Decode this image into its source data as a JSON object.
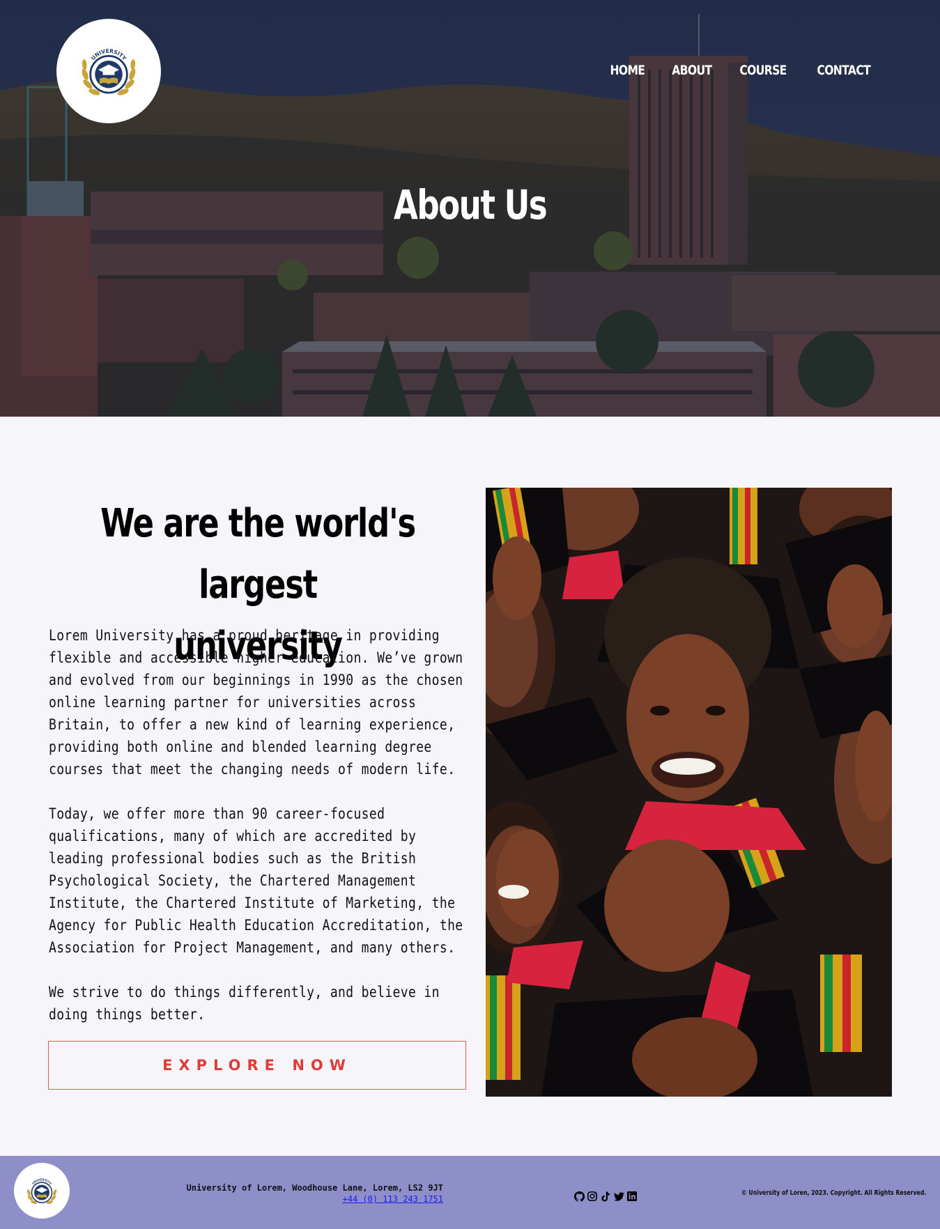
{
  "header": {
    "logo_text": "UNIVERSITY",
    "nav": [
      {
        "label": "HOME"
      },
      {
        "label": "ABOUT"
      },
      {
        "label": "COURSE"
      },
      {
        "label": "CONTACT"
      }
    ],
    "hero_title": "About Us"
  },
  "about": {
    "heading_line1": "We are the world's largest",
    "heading_line2": "university",
    "paragraphs": [
      "Lorem University has a proud heritage in providing flexible and accessible higher education. We’ve grown and evolved from our beginnings in 1990 as the chosen online learning partner for universities across Britain, to offer a new kind of learning experience, providing both online and blended learning degree courses that meet the changing needs of modern life.",
      "Today, we offer more than 90 career-focused qualifications, many of which are accredited by leading professional bodies such as the British Psychological Society, the Chartered Management Institute, the Chartered Institute of Marketing, the Agency for Public Health Education Accreditation, the Association for Project Management, and many others.",
      "We strive to do things differently, and believe in doing things better."
    ],
    "button_label": "EXPLORE NOW"
  },
  "footer": {
    "logo_text": "UNIVERSITY",
    "address": "University of Lorem, Woodhouse Lane, Lorem, LS2 9JT",
    "phone": "+44 (0) 113 243 1751",
    "socials": [
      "github-icon",
      "instagram-icon",
      "tiktok-icon",
      "twitter-icon",
      "linkedin-icon"
    ],
    "copyright": "© University of Loren, 2023. Copyright. All Rights Reserved."
  },
  "colors": {
    "accent_red": "#e03b36",
    "footer_bg": "#8e8fc8",
    "page_bg": "#f6f5fa",
    "logo_gold": "#c9a43a",
    "logo_navy": "#1f3a68"
  }
}
